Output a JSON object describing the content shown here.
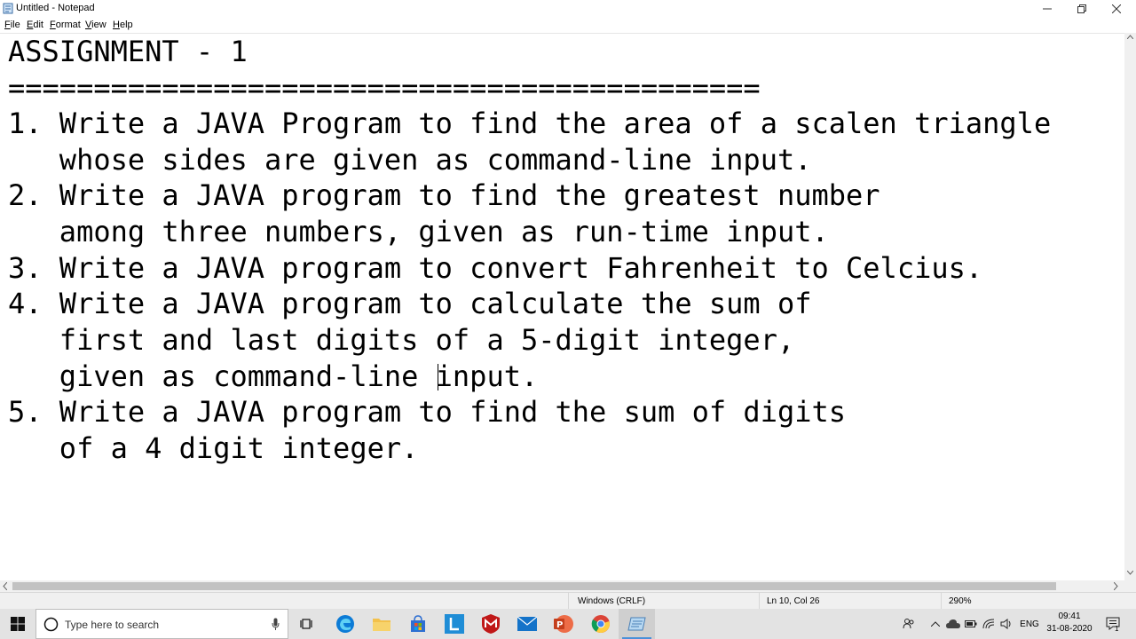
{
  "window": {
    "title": "Untitled - Notepad"
  },
  "menu": {
    "file": "F",
    "file_rest": "ile",
    "edit": "E",
    "edit_rest": "dit",
    "format": "F",
    "format_pre": "",
    "format_rest": "ormat",
    "view": "V",
    "view_rest": "iew",
    "help": "H",
    "help_rest": "elp"
  },
  "editor": {
    "lines": [
      "ASSIGNMENT - 1",
      "============================================",
      "1. Write a JAVA Program to find the area of a scalen triangle",
      "   whose sides are given as command-line input.",
      "2. Write a JAVA program to find the greatest number",
      "   among three numbers, given as run-time input.",
      "3. Write a JAVA program to convert Fahrenheit to Celcius.",
      "4. Write a JAVA program to calculate the sum of",
      "   first and last digits of a 5-digit integer,",
      "   given as command-line input.",
      "5. Write a JAVA program to find the sum of digits",
      "   of a 4 digit integer."
    ]
  },
  "status": {
    "encoding": "Windows (CRLF)",
    "position": "Ln 10, Col 26",
    "zoom": "290%"
  },
  "taskbar": {
    "search_placeholder": "Type here to search",
    "language": "ENG",
    "time": "09:41",
    "date": "31-08-2020",
    "notification_count": "1"
  }
}
